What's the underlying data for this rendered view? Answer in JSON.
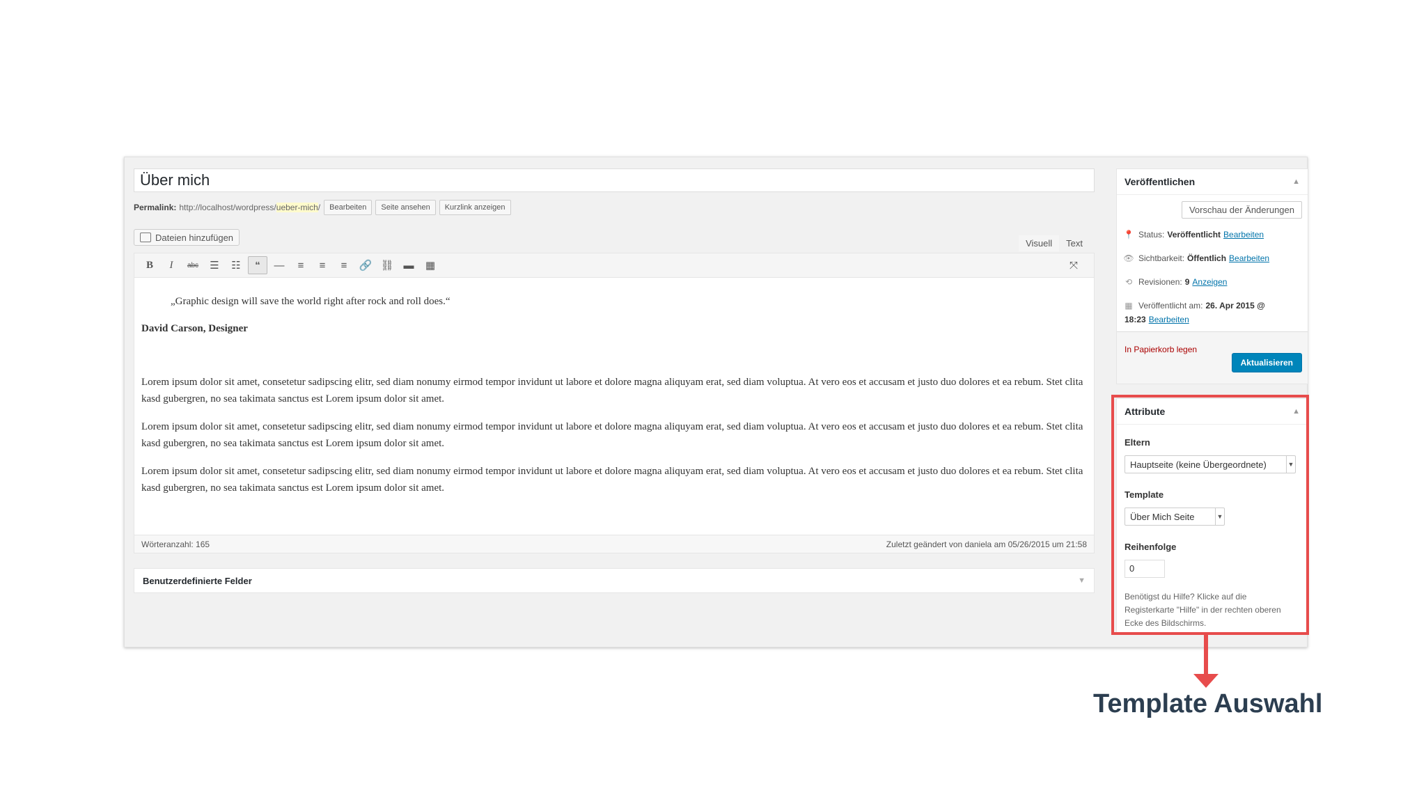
{
  "page_title": "Über mich",
  "permalink": {
    "label": "Permalink:",
    "base": "http://localhost/wordpress/",
    "slug": "ueber-mich",
    "trail": "/",
    "buttons": [
      "Bearbeiten",
      "Seite ansehen",
      "Kurzlink anzeigen"
    ]
  },
  "media_button": "Dateien hinzufügen",
  "editor_tabs": {
    "visual": "Visuell",
    "text": "Text"
  },
  "content": {
    "quote": "„Graphic design will save the world right after rock and roll does.“",
    "author": "David Carson, Designer",
    "paragraphs": [
      "Lorem ipsum dolor sit amet, consetetur sadipscing elitr, sed diam nonumy eirmod tempor invidunt ut labore et dolore magna aliquyam erat, sed diam voluptua. At vero eos et accusam et justo duo dolores et ea rebum. Stet clita kasd gubergren, no sea takimata sanctus est Lorem ipsum dolor sit amet.",
      "Lorem ipsum dolor sit amet, consetetur sadipscing elitr, sed diam nonumy eirmod tempor invidunt ut labore et dolore magna aliquyam erat, sed diam voluptua. At vero eos et accusam et justo duo dolores et ea rebum. Stet clita kasd gubergren, no sea takimata sanctus est Lorem ipsum dolor sit amet.",
      "Lorem ipsum dolor sit amet, consetetur sadipscing elitr, sed diam nonumy eirmod tempor invidunt ut labore et dolore magna aliquyam erat, sed diam voluptua. At vero eos et accusam et justo duo dolores et ea rebum. Stet clita kasd gubergren, no sea takimata sanctus est Lorem ipsum dolor sit amet."
    ]
  },
  "status_bar": {
    "word_count": "Wörteranzahl: 165",
    "last_edit": "Zuletzt geändert von daniela am 05/26/2015 um 21:58"
  },
  "custom_fields": "Benutzerdefinierte Felder",
  "publish": {
    "title": "Veröffentlichen",
    "preview": "Vorschau der Änderungen",
    "status_label": "Status:",
    "status_value": "Veröffentlicht",
    "visibility_label": "Sichtbarkeit:",
    "visibility_value": "Öffentlich",
    "revisions_label": "Revisionen:",
    "revisions_value": "9",
    "revisions_link": "Anzeigen",
    "published_label": "Veröffentlicht am:",
    "published_value": "26. Apr 2015 @",
    "published_time": "18:23",
    "edit_link": "Bearbeiten",
    "trash": "In Papierkorb legen",
    "update": "Aktualisieren"
  },
  "attributes": {
    "title": "Attribute",
    "parent_label": "Eltern",
    "parent_value": "Hauptseite (keine Übergeordnete)",
    "template_label": "Template",
    "template_value": "Über Mich Seite",
    "order_label": "Reihenfolge",
    "order_value": "0",
    "help": "Benötigst du Hilfe? Klicke auf die Registerkarte \"Hilfe\" in der rechten oberen Ecke des Bildschirms."
  },
  "annotation": "Template Auswahl",
  "colors": {
    "highlight": "#e74c4c",
    "primary_button": "#0085ba",
    "link": "#0073aa"
  }
}
